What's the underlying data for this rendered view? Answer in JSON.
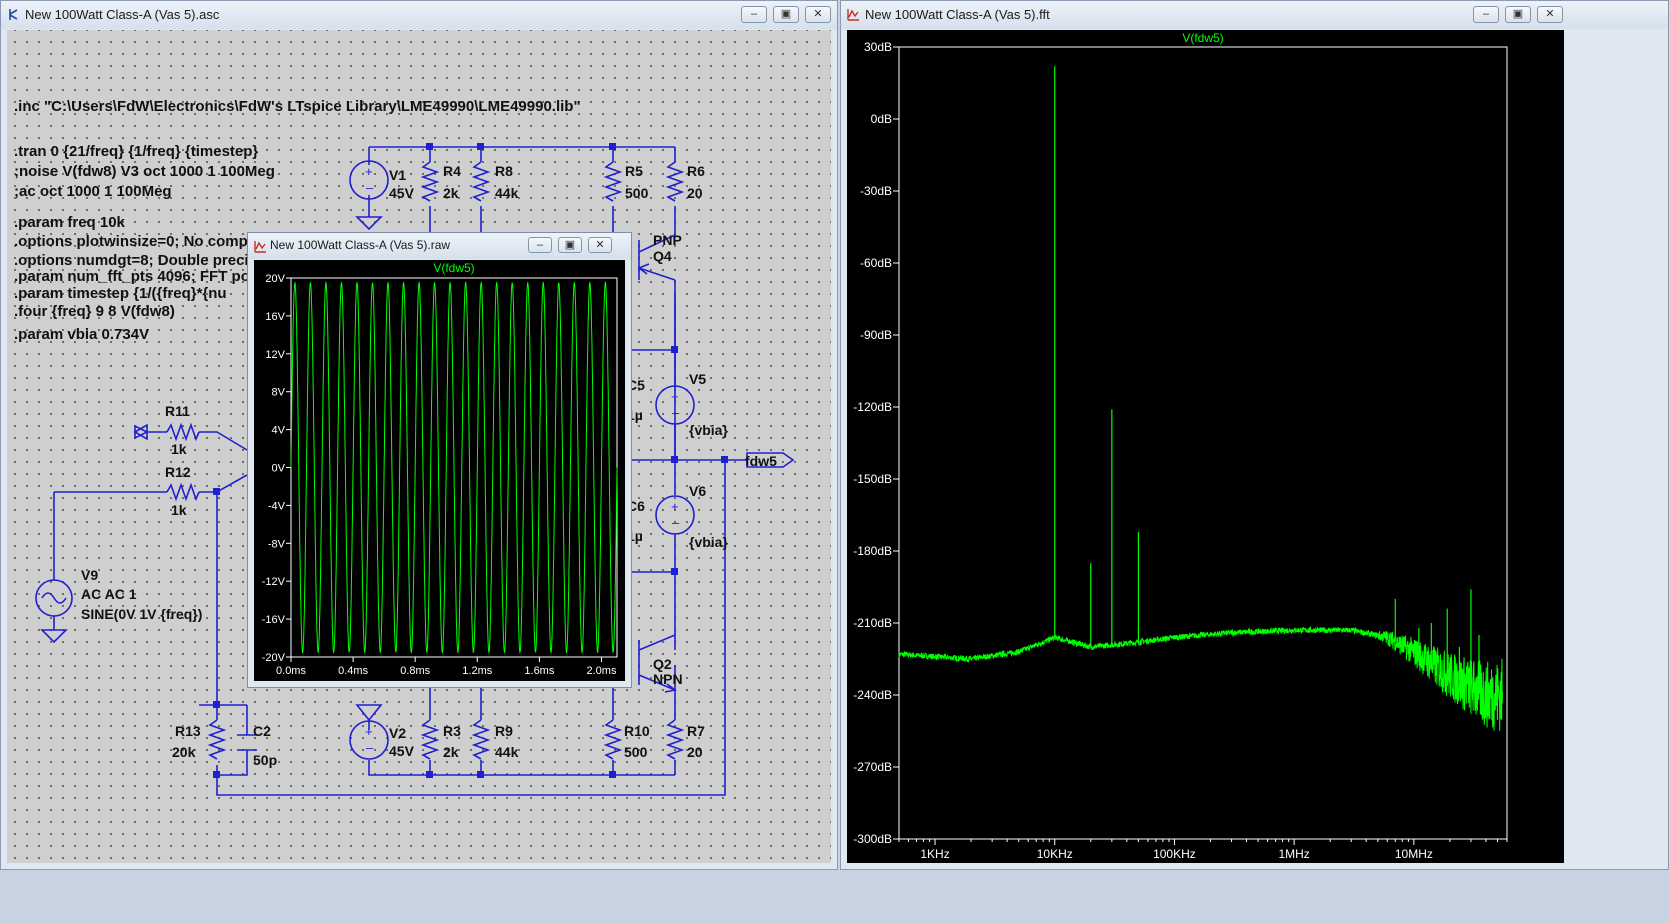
{
  "schematic_window": {
    "title": "New 100Watt Class-A (Vas 5).asc",
    "directives": [
      ".inc \"C:\\Users\\FdW\\Electronics\\FdW's LTspice Library\\LME49990\\LME49990.lib\"",
      ".tran 0 {21/freq} {1/freq} {timestep}",
      ";noise V(fdw8) V3 oct 1000 1 100Meg",
      ";ac oct 1000 1 100Meg",
      ".param freq 10k",
      ".options plotwinsize=0; No compr",
      ".options numdgt=8; Double precisi",
      ".param num_fft_pts 4096; FFT po",
      ".param timestep {1/({freq}*{nu",
      ".four {freq} 9 8 V(fdw8)",
      ".param vbia 0.734V"
    ],
    "components": {
      "V1": {
        "name": "V1",
        "value": "45V"
      },
      "R4": {
        "name": "R4",
        "value": "2k"
      },
      "R8": {
        "name": "R8",
        "value": "44k"
      },
      "R5": {
        "name": "R5",
        "value": "500"
      },
      "R6": {
        "name": "R6",
        "value": "20"
      },
      "Q4": {
        "name": "PNP",
        "value": "Q4"
      },
      "C5": {
        "name": "C5",
        "value": "1µ"
      },
      "V5": {
        "name": "V5",
        "value": "{vbia}"
      },
      "net": "fdw5",
      "C6": {
        "name": "C6",
        "value": "1µ"
      },
      "V6": {
        "name": "V6",
        "value": "{vbia}"
      },
      "R11": {
        "name": "R11",
        "value": "1k"
      },
      "R12": {
        "name": "R12",
        "value": "1k"
      },
      "V9": {
        "name": "V9",
        "line1": "AC AC 1",
        "line2": "SINE(0V 1V {freq})"
      },
      "Q2": {
        "name": "Q2",
        "value": "NPN"
      },
      "R13": {
        "name": "R13",
        "value": "20k"
      },
      "C2": {
        "name": "C2",
        "value": "50p"
      },
      "V2": {
        "name": "V2",
        "value": "45V"
      },
      "R3": {
        "name": "R3",
        "value": "2k"
      },
      "R9": {
        "name": "R9",
        "value": "44k"
      },
      "R10": {
        "name": "R10",
        "value": "500"
      },
      "R7": {
        "name": "R7",
        "value": "20"
      }
    }
  },
  "raw_window": {
    "title": "New 100Watt Class-A (Vas 5).raw",
    "trace_label": "V(fdw5)",
    "y_ticks": [
      "20V",
      "16V",
      "12V",
      "8V",
      "4V",
      "0V",
      "-4V",
      "-8V",
      "-12V",
      "-16V",
      "-20V"
    ],
    "x_ticks": [
      "0.0ms",
      "0.4ms",
      "0.8ms",
      "1.2ms",
      "1.6ms",
      "2.0ms"
    ]
  },
  "fft_window": {
    "title": "New 100Watt Class-A (Vas 5).fft",
    "trace_label": "V(fdw5)",
    "y_ticks": [
      "30dB",
      "0dB",
      "-30dB",
      "-60dB",
      "-90dB",
      "-120dB",
      "-150dB",
      "-180dB",
      "-210dB",
      "-240dB",
      "-270dB",
      "-300dB"
    ],
    "x_ticks": [
      "1KHz",
      "10KHz",
      "100KHz",
      "1MHz",
      "10MHz"
    ]
  },
  "window_buttons": {
    "minimize": "–",
    "restore": "▣",
    "close": "✕"
  },
  "colors": {
    "trace": "#00ff00",
    "wire": "#0000ff",
    "plot_bg": "#000000",
    "schematic_bg": "#cfcfcf"
  },
  "chart_data": [
    {
      "type": "line",
      "title": "V(fdw5)",
      "xlabel": "",
      "ylabel": "",
      "xlim_ms": [
        0,
        2.1
      ],
      "ylim": [
        -20,
        20
      ],
      "series": [
        {
          "name": "V(fdw5)",
          "waveform": "sine",
          "amplitude_V": 19.5,
          "frequency_Hz": 10000,
          "cycles": 21
        }
      ],
      "grid": false
    },
    {
      "type": "line",
      "title": "V(fdw5)",
      "x_scale": "log",
      "xlim_Hz": [
        500,
        60000000
      ],
      "ylim_dB": [
        -300,
        30
      ],
      "series": [
        {
          "name": "V(fdw5)",
          "noise_floor": [
            [
              500,
              -223
            ],
            [
              2000,
              -225
            ],
            [
              5000,
              -222
            ],
            [
              8000,
              -218
            ],
            [
              10000,
              -216
            ],
            [
              20000,
              -220
            ],
            [
              50000,
              -218
            ],
            [
              100000,
              -216
            ],
            [
              300000,
              -214
            ],
            [
              1000000,
              -213
            ],
            [
              3000000,
              -213
            ],
            [
              6000000,
              -216
            ],
            [
              10000000,
              -222
            ],
            [
              20000000,
              -232
            ],
            [
              40000000,
              -240
            ],
            [
              55000000,
              -240
            ]
          ],
          "peaks": [
            [
              10000,
              22
            ],
            [
              20000,
              -185
            ],
            [
              30000,
              -121
            ],
            [
              50000,
              -172
            ],
            [
              7000000,
              -200
            ],
            [
              11000000,
              -212
            ],
            [
              14000000,
              -210
            ],
            [
              19000000,
              -204
            ],
            [
              24000000,
              -220
            ],
            [
              30000000,
              -196
            ],
            [
              35000000,
              -215
            ]
          ]
        }
      ],
      "grid": false
    }
  ]
}
